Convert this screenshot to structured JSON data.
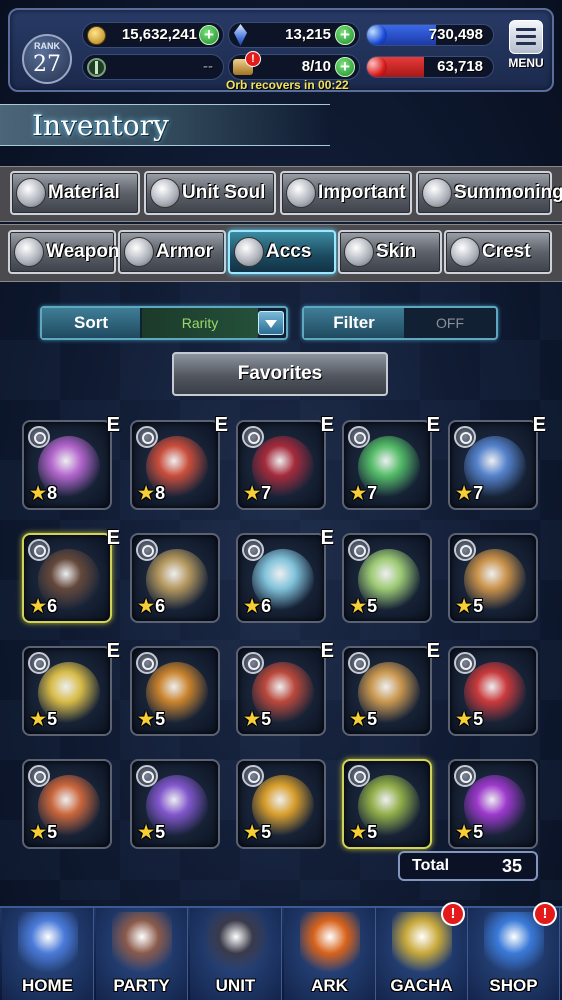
{
  "hud": {
    "rank_label": "RANK",
    "rank_value": "27",
    "gil": "15,632,241",
    "lapis": "13,215",
    "exp_orb": "730,498",
    "friend_value": "--",
    "orb_count": "8/10",
    "stamina_orb": "63,718",
    "orb_recover_text": "Orb recovers in 00:22",
    "menu_label": "MENU",
    "orb_blue_fill": 0.55,
    "orb_red_fill": 0.45
  },
  "page": {
    "title": "Inventory"
  },
  "tabs_row1": [
    {
      "label": "Material",
      "icon": "bag-icon"
    },
    {
      "label": "Unit Soul",
      "icon": "soul-flame-icon"
    },
    {
      "label": "Important",
      "icon": "star-icon"
    },
    {
      "label": "Summoning",
      "icon": "summon-crest-icon"
    }
  ],
  "tabs_row2": [
    {
      "label": "Weapon",
      "icon": "sword-icon"
    },
    {
      "label": "Armor",
      "icon": "armor-icon"
    },
    {
      "label": "Accs",
      "icon": "ring-icon",
      "active": true
    },
    {
      "label": "Skin",
      "icon": "hanger-icon"
    },
    {
      "label": "Crest",
      "icon": "crest-icon"
    }
  ],
  "controls": {
    "sort_label": "Sort",
    "sort_value": "Rarity",
    "filter_label": "Filter",
    "filter_value": "OFF",
    "favorites_label": "Favorites"
  },
  "items": [
    {
      "rarity": "8",
      "equipped": "E",
      "color": "#c06ad8"
    },
    {
      "rarity": "8",
      "equipped": "E",
      "color": "#d8503a"
    },
    {
      "rarity": "7",
      "equipped": "E",
      "color": "#b02a3a"
    },
    {
      "rarity": "7",
      "equipped": "E",
      "color": "#58c86a"
    },
    {
      "rarity": "7",
      "equipped": "E",
      "color": "#5a8ad8"
    },
    {
      "rarity": "6",
      "equipped": "E",
      "color": "#6a4a3a"
    },
    {
      "rarity": "6",
      "equipped": "",
      "color": "#c0a060"
    },
    {
      "rarity": "6",
      "equipped": "E",
      "color": "#8ad0e8"
    },
    {
      "rarity": "5",
      "equipped": "",
      "color": "#a8d878"
    },
    {
      "rarity": "5",
      "equipped": "",
      "color": "#d89a4a"
    },
    {
      "rarity": "5",
      "equipped": "E",
      "color": "#e8c848"
    },
    {
      "rarity": "5",
      "equipped": "",
      "color": "#d88a2a"
    },
    {
      "rarity": "5",
      "equipped": "E",
      "color": "#c84a3a"
    },
    {
      "rarity": "5",
      "equipped": "E",
      "color": "#d8a050"
    },
    {
      "rarity": "5",
      "equipped": "",
      "color": "#d83a3a"
    },
    {
      "rarity": "5",
      "equipped": "",
      "color": "#d86a3a"
    },
    {
      "rarity": "5",
      "equipped": "",
      "color": "#8a5ad8"
    },
    {
      "rarity": "5",
      "equipped": "",
      "color": "#e8a82a"
    },
    {
      "rarity": "5",
      "equipped": "",
      "color": "#9ab848"
    },
    {
      "rarity": "5",
      "equipped": "",
      "color": "#a83ad8"
    }
  ],
  "total": {
    "label": "Total",
    "value": "35"
  },
  "nav": [
    {
      "label": "HOME",
      "icon": "home-crystal-icon",
      "badge": "",
      "color": "#4a7ad8"
    },
    {
      "label": "PARTY",
      "icon": "party-icon",
      "badge": "",
      "color": "#8a5a4a"
    },
    {
      "label": "UNIT",
      "icon": "unit-icon",
      "badge": "",
      "color": "#3a3a4a"
    },
    {
      "label": "ARK",
      "icon": "ark-phoenix-icon",
      "badge": "",
      "color": "#d8621a"
    },
    {
      "label": "GACHA",
      "icon": "gacha-orb-icon",
      "badge": "!",
      "color": "#c8a83a"
    },
    {
      "label": "SHOP",
      "icon": "shop-crystal-icon",
      "badge": "!",
      "color": "#3a7ad8"
    }
  ]
}
